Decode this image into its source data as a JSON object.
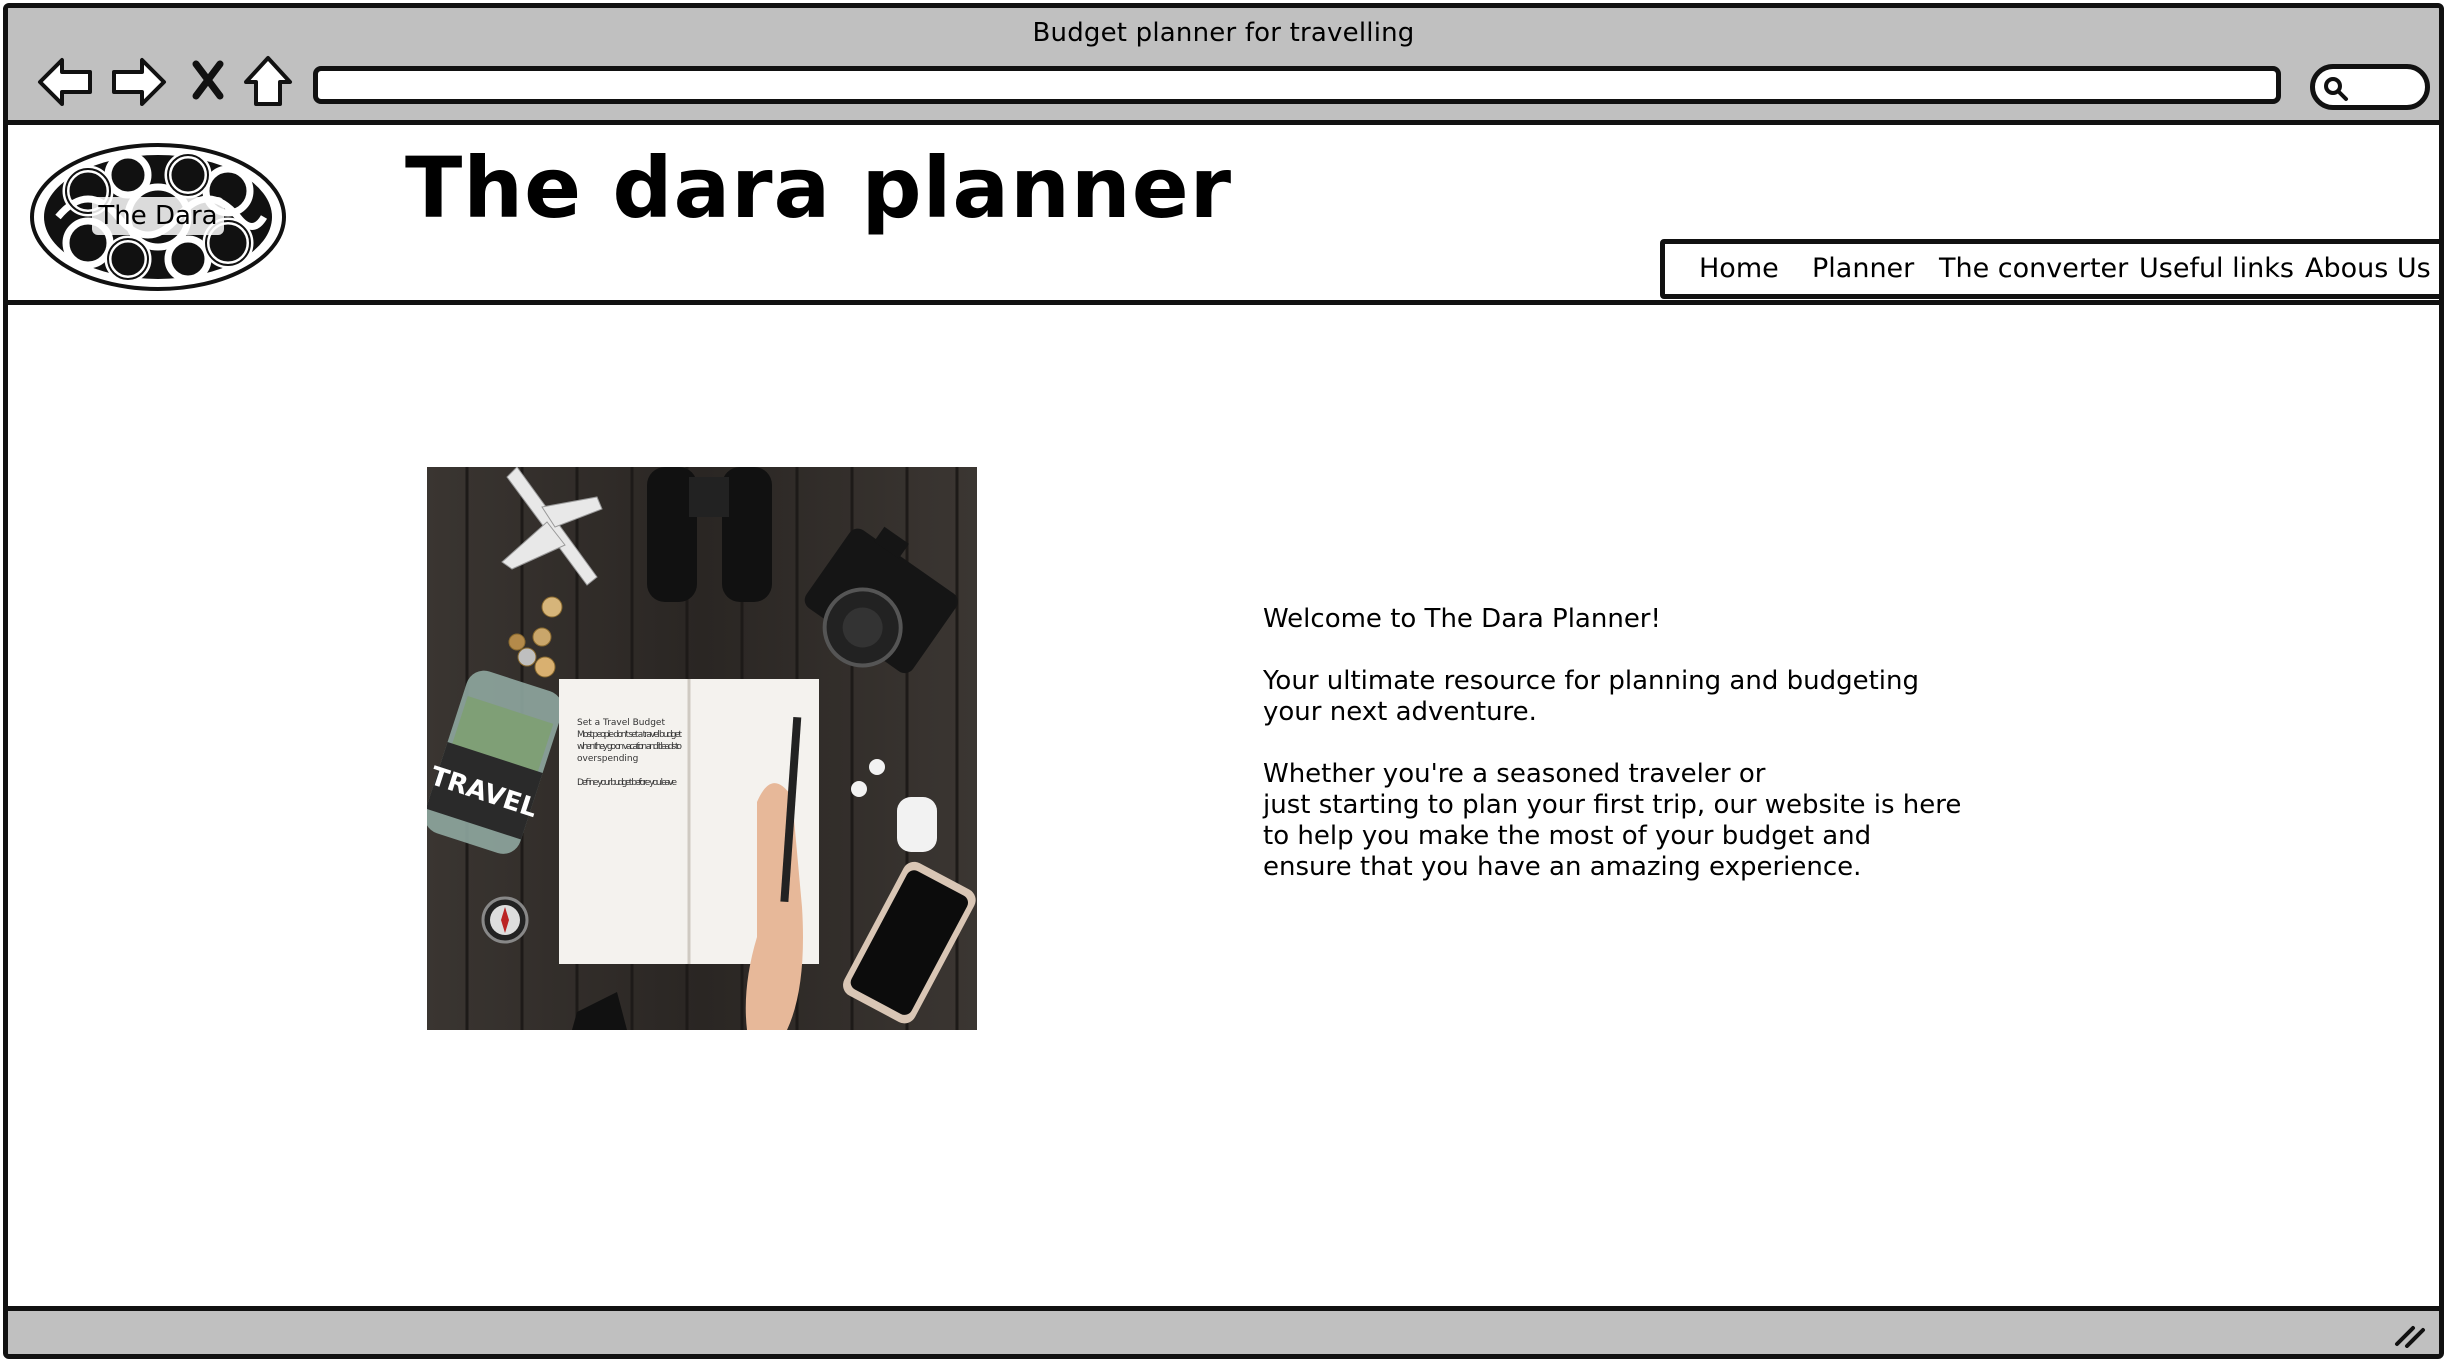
{
  "window": {
    "title": "Budget planner for travelling"
  },
  "toolbar": {
    "back_icon": "back-arrow-icon",
    "forward_icon": "forward-arrow-icon",
    "stop_icon": "close-icon",
    "home_icon": "home-icon",
    "address_value": "",
    "search_icon": "search-icon"
  },
  "header": {
    "logo_text": "The Dara",
    "site_title": "The dara planner",
    "nav": [
      {
        "label": "Home"
      },
      {
        "label": "Planner"
      },
      {
        "label": "The converter"
      },
      {
        "label": "Useful links"
      },
      {
        "label": "Abous Us"
      }
    ]
  },
  "hero_image": {
    "jar_label": "TRAVEL",
    "notebook_lines": [
      "Set a Travel Budget",
      "Most people don't set a travel budget",
      "when they go on vacation and it leads to",
      "overspending",
      "Define your budget before you leave"
    ]
  },
  "welcome": {
    "heading": "Welcome to The Dara Planner!",
    "intro_lines": [
      "Your ultimate resource for planning and budgeting",
      "your next adventure."
    ],
    "body_lines": [
      "Whether you're a seasoned traveler or",
      "just starting to plan your first trip, our website is here",
      "to help you make the most of your budget and",
      "ensure that you have an amazing experience."
    ]
  },
  "colors": {
    "chrome_gray": "#c0c0c0",
    "border": "#111111",
    "page_bg": "#ffffff"
  }
}
